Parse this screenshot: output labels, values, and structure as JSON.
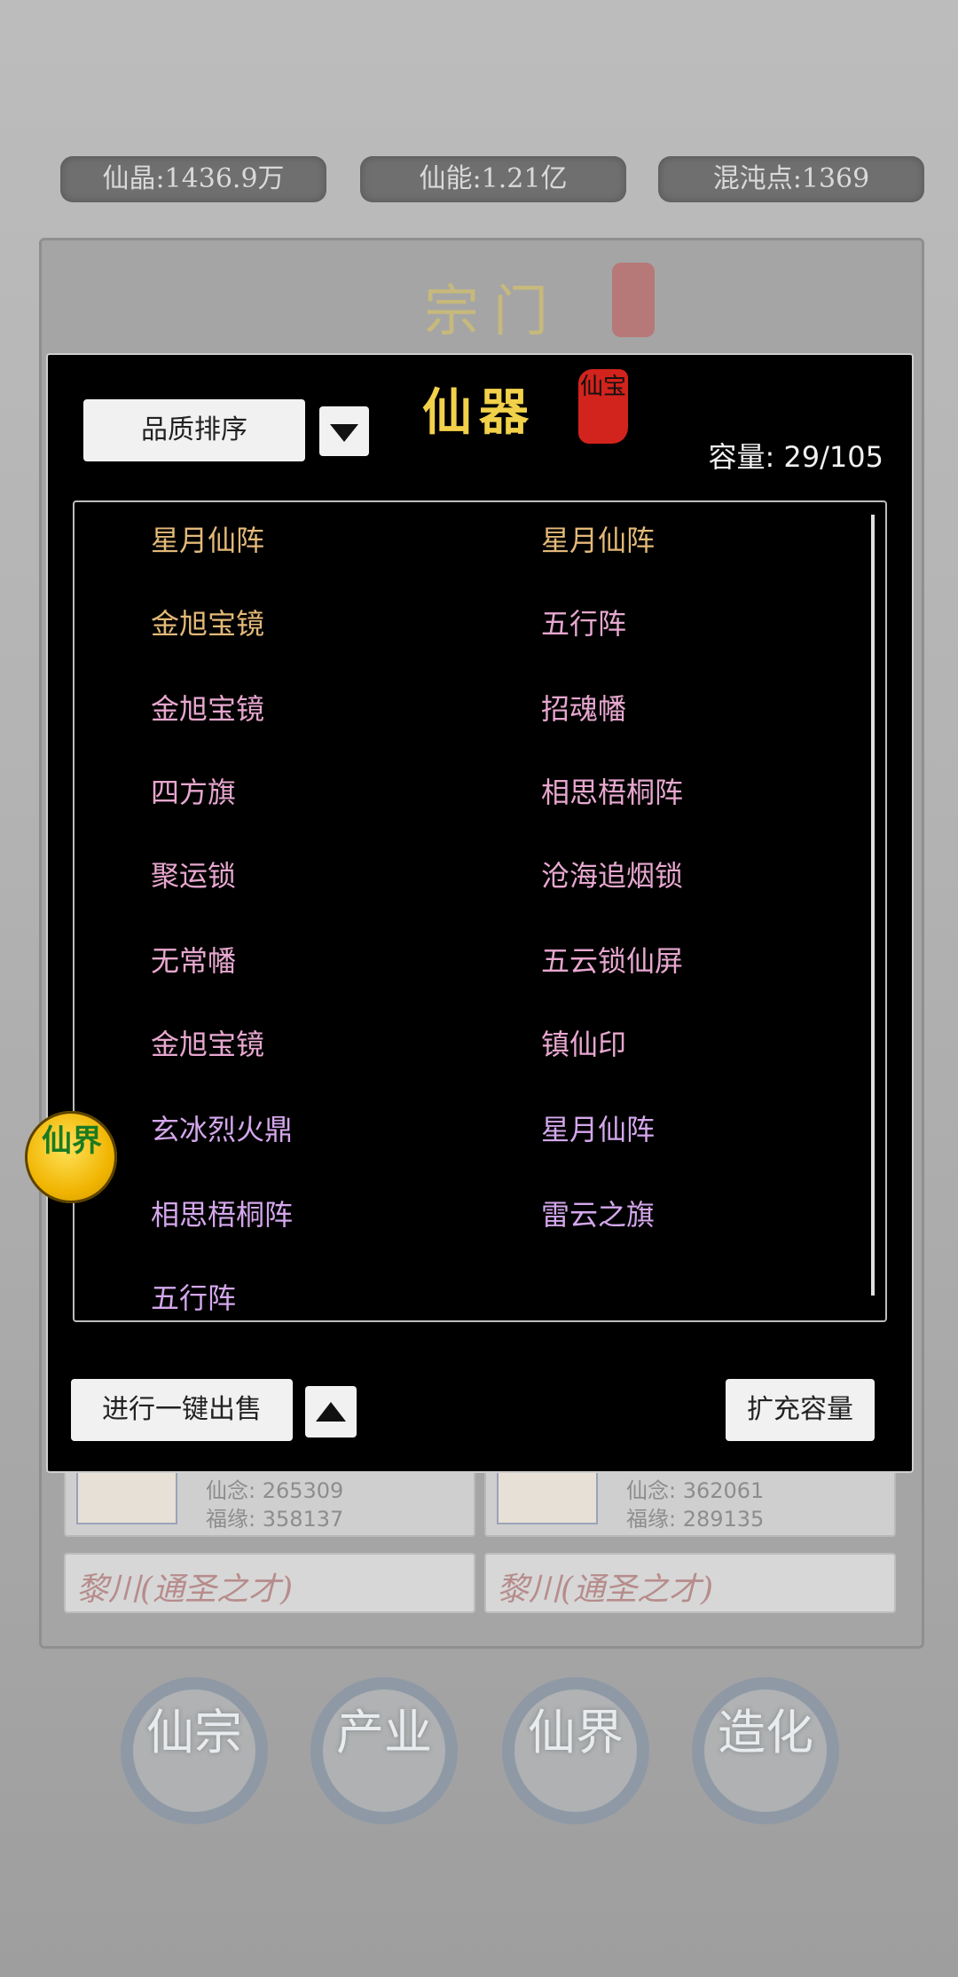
{
  "resources": {
    "xianjing": "仙晶:1436.9万",
    "xianneng": "仙能:1.21亿",
    "hundun": "混沌点:1369"
  },
  "sect": {
    "title": "宗门",
    "members": [
      {
        "xiannian": "仙念: 265309",
        "fuyuan": "福缘: 358137"
      },
      {
        "xiannian": "仙念: 362061",
        "fuyuan": "福缘: 289135"
      }
    ],
    "names": [
      "黎川(通圣之才)",
      "黎川(通圣之才)"
    ]
  },
  "modal": {
    "title": "仙器",
    "seal_text": "仙宝",
    "sort_label": "品质排序",
    "capacity": "容量: 29/105",
    "sell_all_label": "进行一键出售",
    "expand_label": "扩充容量",
    "items": [
      {
        "name": "星月仙阵",
        "color": "#e3b978"
      },
      {
        "name": "星月仙阵",
        "color": "#e3b978"
      },
      {
        "name": "金旭宝镜",
        "color": "#e3b978"
      },
      {
        "name": "五行阵",
        "color": "#e7a7cf"
      },
      {
        "name": "金旭宝镜",
        "color": "#e7a7cf"
      },
      {
        "name": "招魂幡",
        "color": "#e7a7cf"
      },
      {
        "name": "四方旗",
        "color": "#e7a7cf"
      },
      {
        "name": "相思梧桐阵",
        "color": "#e7a7cf"
      },
      {
        "name": "聚运锁",
        "color": "#e7a7cf"
      },
      {
        "name": "沧海追烟锁",
        "color": "#e7a7cf"
      },
      {
        "name": "无常幡",
        "color": "#e7a7cf"
      },
      {
        "name": "五云锁仙屏",
        "color": "#e7a7cf"
      },
      {
        "name": "金旭宝镜",
        "color": "#e7a7cf"
      },
      {
        "name": "镇仙印",
        "color": "#e7a7cf"
      },
      {
        "name": "玄冰烈火鼎",
        "color": "#d4a7ec"
      },
      {
        "name": "星月仙阵",
        "color": "#d4a7ec"
      },
      {
        "name": "相思梧桐阵",
        "color": "#d4a7ec"
      },
      {
        "name": "雷云之旗",
        "color": "#d4a7ec"
      },
      {
        "name": "五行阵",
        "color": "#d4a7ec"
      }
    ]
  },
  "float_badge": "仙界",
  "nav": [
    {
      "label": "仙宗"
    },
    {
      "label": "产业"
    },
    {
      "label": "仙界"
    },
    {
      "label": "造化"
    }
  ]
}
